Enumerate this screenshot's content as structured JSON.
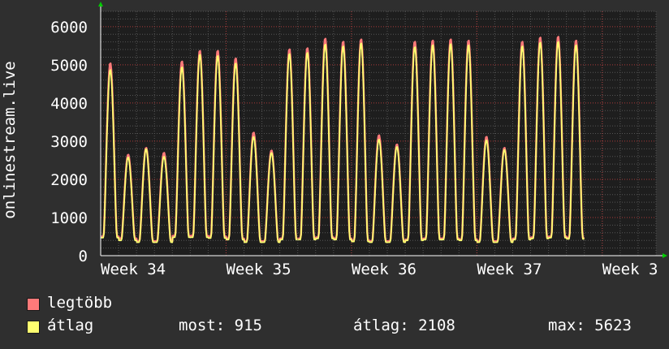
{
  "chart_data": {
    "type": "line",
    "ylabel": "onlinestream.live",
    "ylim": [
      0,
      6400
    ],
    "yticks": [
      0,
      1000,
      2000,
      3000,
      4000,
      5000,
      6000
    ],
    "xticks": [
      "Week 34",
      "Week 35",
      "Week 36",
      "Week 37",
      "Week 3"
    ],
    "grid": true,
    "colors": {
      "background": "#2f2f2f",
      "plot_background": "#1e1e1e",
      "grid_major": "#aa3a3a",
      "grid_minor": "#555555",
      "legtobb": "#ff7a7a",
      "atlag": "#ffff70",
      "axis_arrow": "#00cc00"
    },
    "x_unit": "days since start of Week 34 display window",
    "x_range_days": [
      0,
      31
    ],
    "week_tick_day": [
      0,
      7,
      14,
      21,
      28
    ],
    "series": [
      {
        "name": "legtöbb",
        "color": "#ff7a7a",
        "daily_peak": [
          5050,
          2650,
          2830,
          2700,
          5100,
          5380,
          5380,
          5180,
          3230,
          2760,
          5420,
          5450,
          5700,
          5620,
          5680,
          3160,
          2920,
          5620,
          5650,
          5680,
          5650,
          3120,
          2830,
          5620,
          5730,
          5750,
          5650
        ],
        "daily_trough": [
          500,
          450,
          380,
          380,
          520,
          520,
          500,
          450,
          380,
          380,
          450,
          450,
          480,
          450,
          400,
          380,
          380,
          420,
          450,
          450,
          420,
          380,
          380,
          450,
          480,
          500,
          470
        ]
      },
      {
        "name": "átlag",
        "color": "#ffff70",
        "daily_peak": [
          4880,
          2580,
          2800,
          2600,
          4950,
          5280,
          5250,
          5050,
          3120,
          2700,
          5300,
          5330,
          5550,
          5500,
          5580,
          3050,
          2860,
          5480,
          5530,
          5560,
          5530,
          3030,
          2780,
          5500,
          5600,
          5620,
          5530
        ],
        "daily_trough": [
          470,
          400,
          350,
          350,
          480,
          480,
          460,
          420,
          350,
          350,
          420,
          420,
          450,
          420,
          370,
          350,
          350,
          400,
          420,
          420,
          400,
          350,
          350,
          420,
          450,
          470,
          440
        ]
      }
    ],
    "gap_after_day": 10
  },
  "legend": {
    "items": [
      {
        "label": "legtöbb",
        "color": "#ff7a7a"
      },
      {
        "label": "átlag",
        "color": "#ffff70"
      }
    ],
    "stats": {
      "most": "most: 915",
      "atlag": "átlag: 2108",
      "max": "max: 5623"
    }
  }
}
